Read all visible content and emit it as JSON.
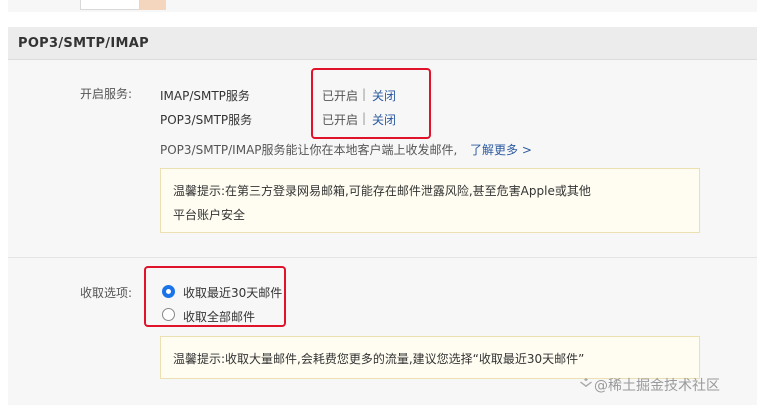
{
  "section": {
    "title": "POP3/SMTP/IMAP"
  },
  "services": {
    "label": "开启服务:",
    "items": [
      {
        "name": "IMAP/SMTP服务",
        "status": "已开启",
        "action": "关闭"
      },
      {
        "name": "POP3/SMTP服务",
        "status": "已开启",
        "action": "关闭"
      }
    ],
    "separator": "|",
    "description": "POP3/SMTP/IMAP服务能让你在本地客户端上收发邮件,",
    "learn_more": "了解更多 >",
    "tip_line1": "温馨提示:在第三方登录网易邮箱,可能存在邮件泄露风险,甚至危害Apple或其他",
    "tip_line2": "平台账户安全"
  },
  "receive": {
    "label": "收取选项:",
    "options": [
      {
        "label": "收取最近30天邮件",
        "selected": true
      },
      {
        "label": "收取全部邮件",
        "selected": false
      }
    ],
    "tip": "温馨提示:收取大量邮件,会耗费您更多的流量,建议您选择“收取最近30天邮件”"
  },
  "watermark": "@稀土掘金技术社区",
  "colors": {
    "accent": "#1a73e8",
    "link": "#2c5aa0",
    "highlight": "#e0132b",
    "tip_bg": "#fffdf1"
  }
}
